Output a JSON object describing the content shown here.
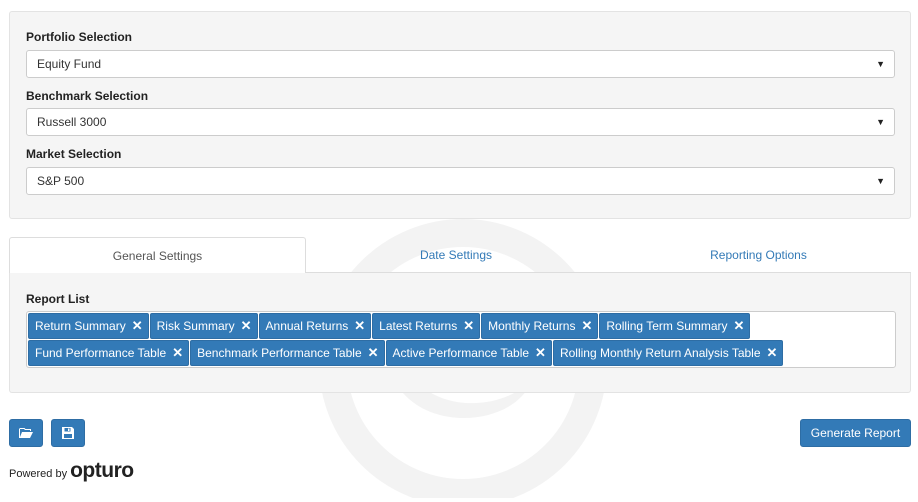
{
  "selections": {
    "portfolio": {
      "label": "Portfolio Selection",
      "value": "Equity Fund"
    },
    "benchmark": {
      "label": "Benchmark Selection",
      "value": "Russell 3000"
    },
    "market": {
      "label": "Market Selection",
      "value": "S&P 500"
    }
  },
  "tabs": [
    {
      "label": "General Settings",
      "active": true
    },
    {
      "label": "Date Settings",
      "active": false
    },
    {
      "label": "Reporting Options",
      "active": false
    }
  ],
  "report_list": {
    "label": "Report List",
    "rows": [
      [
        "Return Summary",
        "Risk Summary",
        "Annual Returns",
        "Latest Returns",
        "Monthly Returns",
        "Rolling Term Summary"
      ],
      [
        "Fund Performance Table",
        "Benchmark Performance Table",
        "Active Performance Table",
        "Rolling Monthly Return Analysis Table"
      ]
    ],
    "remove_glyph": "✕"
  },
  "actions": {
    "open_icon": "folder-open-icon",
    "save_icon": "floppy-disk-icon",
    "generate_label": "Generate Report"
  },
  "footer": {
    "powered_by": "Powered by",
    "brand": "opturo"
  },
  "colors": {
    "primary": "#337ab7",
    "panel": "#f5f5f5",
    "border": "#e3e3e3"
  }
}
